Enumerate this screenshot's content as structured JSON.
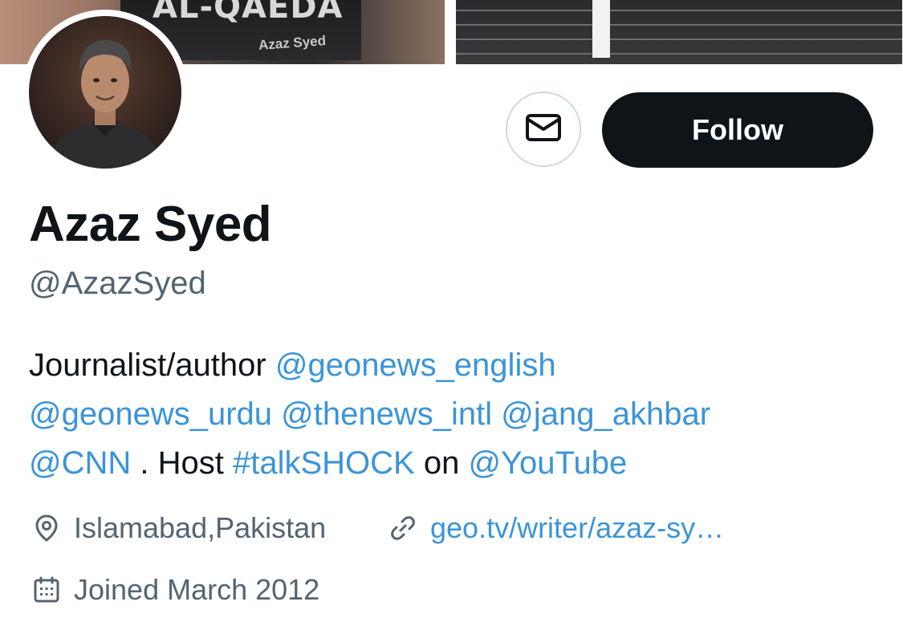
{
  "banner": {
    "book_title": "AL-QAEDA",
    "book_author": "Azaz Syed"
  },
  "profile": {
    "name": "Azaz Syed",
    "handle": "@AzazSyed"
  },
  "actions": {
    "message_icon": "envelope-icon",
    "follow_label": "Follow"
  },
  "bio": {
    "lines": [
      [
        {
          "text": "Journalist/author ",
          "link": false
        },
        {
          "text": "@geonews_english",
          "link": true
        }
      ],
      [
        {
          "text": "@geonews_urdu",
          "link": true
        },
        {
          "text": " ",
          "link": false
        },
        {
          "text": "@thenews_intl",
          "link": true
        },
        {
          "text": " ",
          "link": false
        },
        {
          "text": "@jang_akhbar",
          "link": true
        }
      ],
      [
        {
          "text": "@CNN",
          "link": true
        },
        {
          "text": " . Host ",
          "link": false
        },
        {
          "text": "#talkSHOCK",
          "link": true
        },
        {
          "text": " on ",
          "link": false
        },
        {
          "text": "@YouTube",
          "link": true
        }
      ]
    ]
  },
  "meta": {
    "location": "Islamabad,Pakistan",
    "location_icon": "location-pin-icon",
    "url": "geo.tv/writer/azaz-sy…",
    "url_icon": "link-icon",
    "joined": "Joined March 2012",
    "joined_icon": "calendar-icon"
  },
  "colors": {
    "text": "#0f1419",
    "secondary": "#536471",
    "link": "#3b94d9",
    "button_dark": "#0f1419",
    "border": "#cfd9de"
  }
}
